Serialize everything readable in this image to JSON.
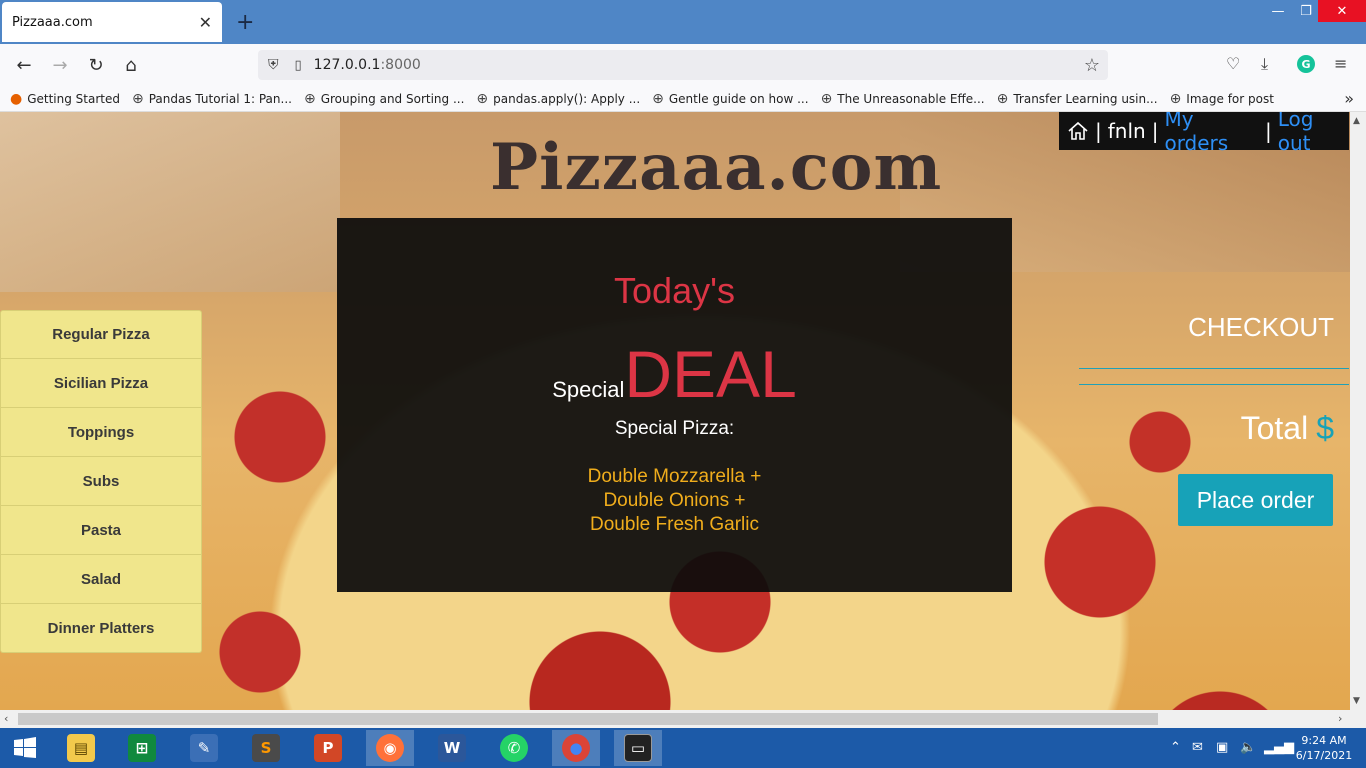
{
  "browser": {
    "tab_title": "Pizzaaa.com",
    "url_host": "127.0.0.1",
    "url_port": ":8000"
  },
  "bookmarks": [
    {
      "label": "Getting Started",
      "icon": "firefox-icon"
    },
    {
      "label": "Pandas Tutorial 1: Pan...",
      "icon": "globe-icon"
    },
    {
      "label": "Grouping and Sorting ...",
      "icon": "globe-icon"
    },
    {
      "label": "pandas.apply(): Apply ...",
      "icon": "globe-icon"
    },
    {
      "label": "Gentle guide on how ...",
      "icon": "globe-icon"
    },
    {
      "label": "The Unreasonable Effe...",
      "icon": "globe-icon"
    },
    {
      "label": "Transfer Learning usin...",
      "icon": "globe-icon"
    },
    {
      "label": "Image for post",
      "icon": "globe-icon"
    }
  ],
  "site": {
    "title": "Pizzaaa.com",
    "nav": {
      "username": "fnln",
      "my_orders": "My orders",
      "log_out": "Log out",
      "separator": "|"
    },
    "deal": {
      "todays": "Today's",
      "special": "Special",
      "deal": "DEAL",
      "special_pizza_label": "Special Pizza:",
      "lines": [
        "Double Mozzarella +",
        "Double Onions +",
        "Double Fresh Garlic"
      ]
    },
    "menu": [
      "Regular Pizza",
      "Sicilian Pizza",
      "Toppings",
      "Subs",
      "Pasta",
      "Salad",
      "Dinner Platters"
    ],
    "checkout": {
      "title": "CHECKOUT",
      "total_label": "Total",
      "currency": "$",
      "place_order": "Place order"
    }
  },
  "taskbar": {
    "time": "9:24 AM",
    "date": "6/17/2021"
  },
  "colors": {
    "accent_red": "#dc3545",
    "accent_teal": "#17a2b8",
    "menu_bg": "#f0e68c",
    "deal_text": "#f0ad1c",
    "link_blue": "#2e8ff5"
  }
}
